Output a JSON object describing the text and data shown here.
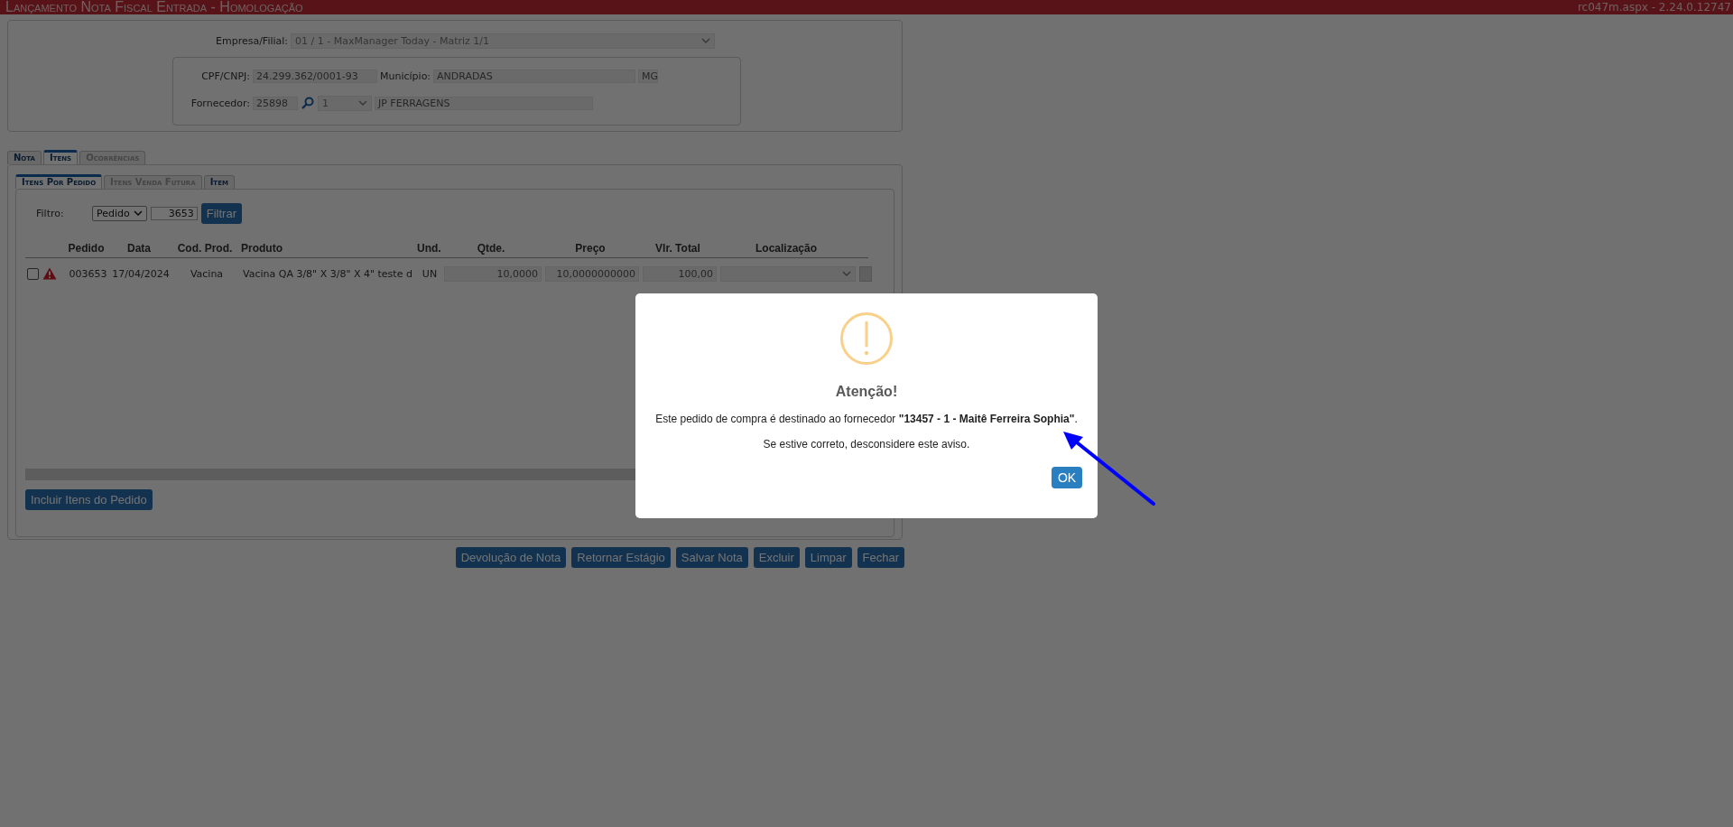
{
  "header": {
    "title": "Lançamento Nota Fiscal Entrada  - Homologação",
    "version": "rc047m.aspx - 2.24.0.12747"
  },
  "company": {
    "label": "Empresa/Filial:",
    "value": "01 / 1 - MaxManager Today - Matriz 1/1"
  },
  "supplier": {
    "cpf_label": "CPF/CNPJ:",
    "cpf": "24.299.362/0001-93",
    "city_label": "Município:",
    "city": "ANDRADAS",
    "state": "MG",
    "supplier_label": "Fornecedor:",
    "code": "25898",
    "branch": "1",
    "name": "JP FERRAGENS"
  },
  "tabs": [
    {
      "label": "Nota",
      "selected": false,
      "disabled": false
    },
    {
      "label": "Itens",
      "selected": true,
      "disabled": false
    },
    {
      "label": "Ocorrências",
      "selected": false,
      "disabled": true
    }
  ],
  "subtabs": [
    {
      "label": "Itens Por Pedido",
      "selected": true,
      "disabled": false
    },
    {
      "label": "Itens Venda Futura",
      "selected": false,
      "disabled": true
    },
    {
      "label": "Item",
      "selected": false,
      "disabled": false
    }
  ],
  "filter": {
    "label": "Filtro:",
    "type": "Pedido",
    "value": "3653",
    "button": "Filtrar"
  },
  "table": {
    "columns": [
      "Pedido",
      "Data",
      "Cod. Prod.",
      "Produto",
      "Und.",
      "Qtde.",
      "Preço",
      "Vlr. Total",
      "Localização"
    ],
    "rows": [
      {
        "checked": false,
        "warning": true,
        "pedido": "003653",
        "data": "17/04/2024",
        "cod": "Vacina",
        "produto": "Vacina QA 3/8\" X 3/8\" X 4\" teste d",
        "und": "UN",
        "qtde": "10,0000",
        "preco": "10,0000000000",
        "total": "100,00"
      }
    ]
  },
  "include_button": "Incluir Itens do Pedido",
  "actions": [
    "Devolução de Nota",
    "Retornar Estágio",
    "Salvar Nota",
    "Excluir",
    "Limpar",
    "Fechar"
  ],
  "dialog": {
    "title": "Atenção!",
    "message": "Este pedido de compra é destinado ao fornecedor **\"13457 - 1 - Maitê Ferreira Sophia\"**.",
    "note": "Se estive correto, desconsidere este aviso.",
    "ok": "OK"
  }
}
